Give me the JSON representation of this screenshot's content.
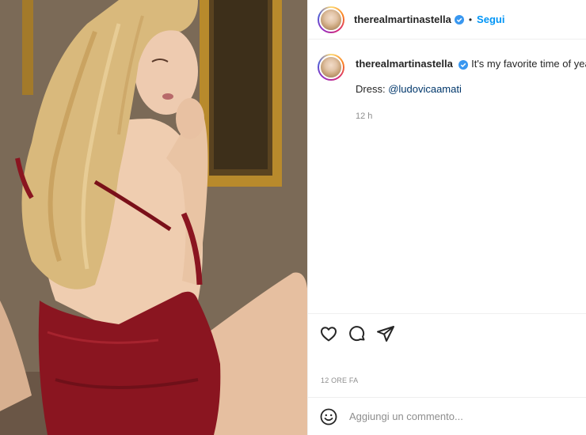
{
  "post": {
    "username": "therealmartinastella",
    "verified_icon": "verified-badge-icon",
    "separator": "•",
    "follow_label": "Segui",
    "caption_text": "It's my favorite time of year..",
    "dress_prefix": "Dress:",
    "dress_mention": "@ludovicaamati",
    "relative_time": "12 h",
    "date_label": "12 ORE FA",
    "comment_placeholder": "Aggiungi un commento..."
  },
  "icons": {
    "like": "heart-icon",
    "comment": "comment-bubble-icon",
    "share": "paper-plane-icon",
    "emoji": "emoji-smile-icon"
  },
  "colors": {
    "accent": "#0095f6",
    "verified": "#3897f0",
    "mention": "#00376b",
    "muted": "#8e8e8e",
    "dress": "#8a1520"
  }
}
